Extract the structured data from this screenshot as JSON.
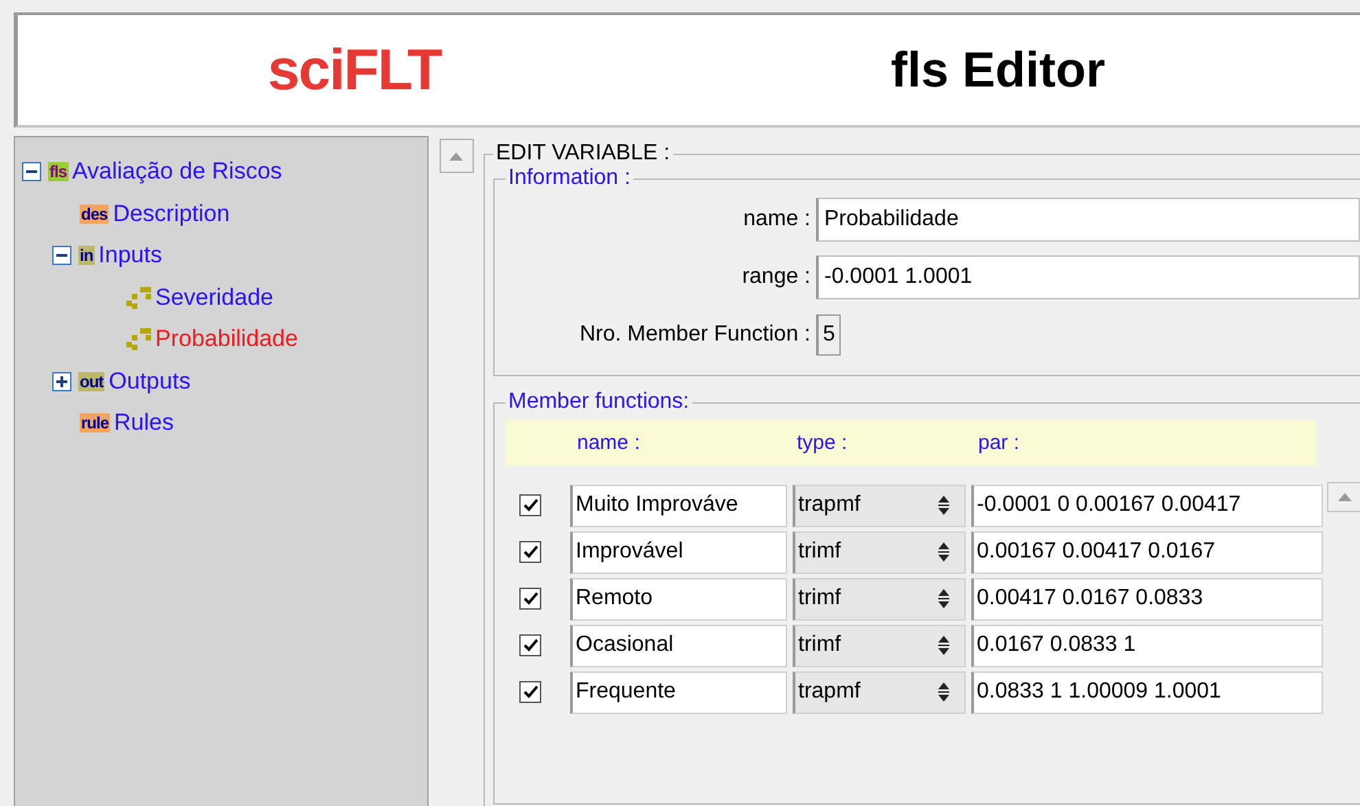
{
  "header": {
    "logo": "sciFLT",
    "title": "fls Editor"
  },
  "tree": [
    {
      "label": "Avaliação de Riscos",
      "badge": "fls",
      "kind": "root",
      "expanded": true,
      "selected": false,
      "children": [
        {
          "label": "Description",
          "badge": "des",
          "kind": "leaf",
          "selected": false
        },
        {
          "label": "Inputs",
          "badge": "in",
          "kind": "group",
          "expanded": true,
          "selected": false,
          "children": [
            {
              "label": "Severidade",
              "kind": "variable",
              "selected": false
            },
            {
              "label": "Probabilidade",
              "kind": "variable",
              "selected": true
            }
          ]
        },
        {
          "label": "Outputs",
          "badge": "out",
          "kind": "group",
          "expanded": false,
          "selected": false
        },
        {
          "label": "Rules",
          "badge": "rule",
          "kind": "leaf",
          "selected": false
        }
      ]
    }
  ],
  "editor": {
    "title": "EDIT VARIABLE :",
    "information": {
      "title": "Information :",
      "name_label": "name :",
      "name": "Probabilidade",
      "range_label": "range :",
      "range": "-0.0001 1.0001",
      "count_label": "Nro. Member Function :",
      "count": "5"
    },
    "member_functions": {
      "title": "Member functions:",
      "columns": [
        "name :",
        "type :",
        "par :"
      ],
      "rows": [
        {
          "checked": true,
          "name": "Muito Improváve",
          "type": "trapmf",
          "par": "-0.0001 0 0.00167 0.00417"
        },
        {
          "checked": true,
          "name": "Improvável",
          "type": "trimf",
          "par": "0.00167 0.00417 0.0167"
        },
        {
          "checked": true,
          "name": "Remoto",
          "type": "trimf",
          "par": "0.00417 0.0167 0.0833"
        },
        {
          "checked": true,
          "name": "Ocasional",
          "type": "trimf",
          "par": "0.0167 0.0833 1"
        },
        {
          "checked": true,
          "name": "Frequente",
          "type": "trapmf",
          "par": "0.0833 1 1.00009 1.0001"
        }
      ]
    }
  }
}
